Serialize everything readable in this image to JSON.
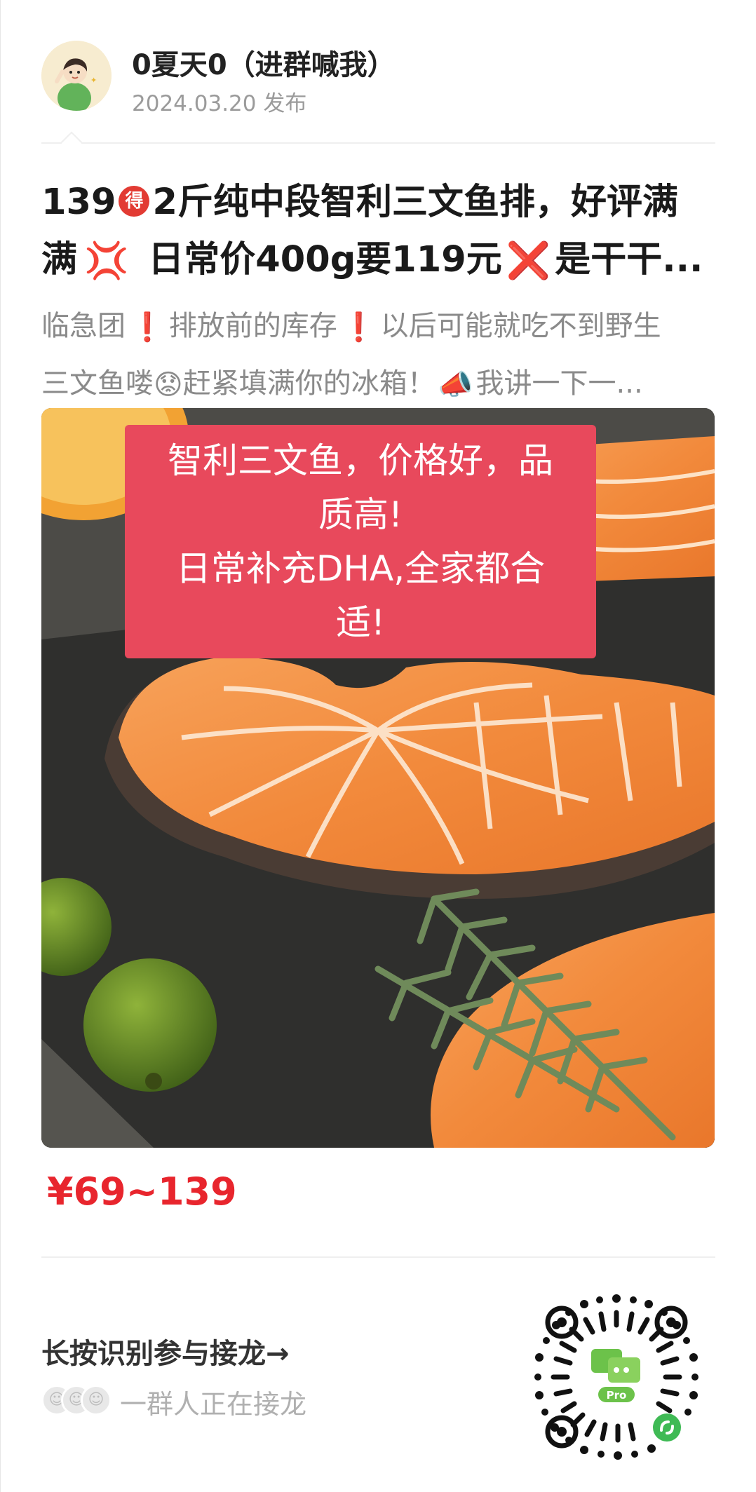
{
  "author": {
    "name": "0夏天0（进群喊我）",
    "date": "2024.03.20 发布"
  },
  "post": {
    "title_lines": [
      [
        "139",
        "得",
        "2斤纯中段智利三文鱼排，好评满"
      ],
      [
        "满",
        "💢",
        " 日常价400g要119元",
        "❌",
        "是干干..."
      ]
    ],
    "desc_lines": [
      [
        "临急团",
        "❗",
        "排放前的库存",
        "❗",
        "以后可能就吃不到野生"
      ],
      [
        "三文鱼喽",
        "😟",
        "赶紧填满你的冰箱！",
        "📣",
        "我讲一下一..."
      ]
    ]
  },
  "product_image": {
    "banner_lines": [
      "智利三文鱼，价格好，品",
      "质高!",
      "日常补充DHA,全家都合",
      "适!"
    ],
    "colors": {
      "banner": "#e8495c",
      "salmon": "#f28a3c",
      "board": "#2f2f2d"
    }
  },
  "price": "¥69~139",
  "join": {
    "title": "长按识别参与接龙→",
    "subtitle": "一群人正在接龙",
    "qr_badge": "Pro"
  },
  "colors": {
    "price": "#e8252d",
    "qr_green": "#6cc24a",
    "text_muted": "#8a8a8a"
  }
}
